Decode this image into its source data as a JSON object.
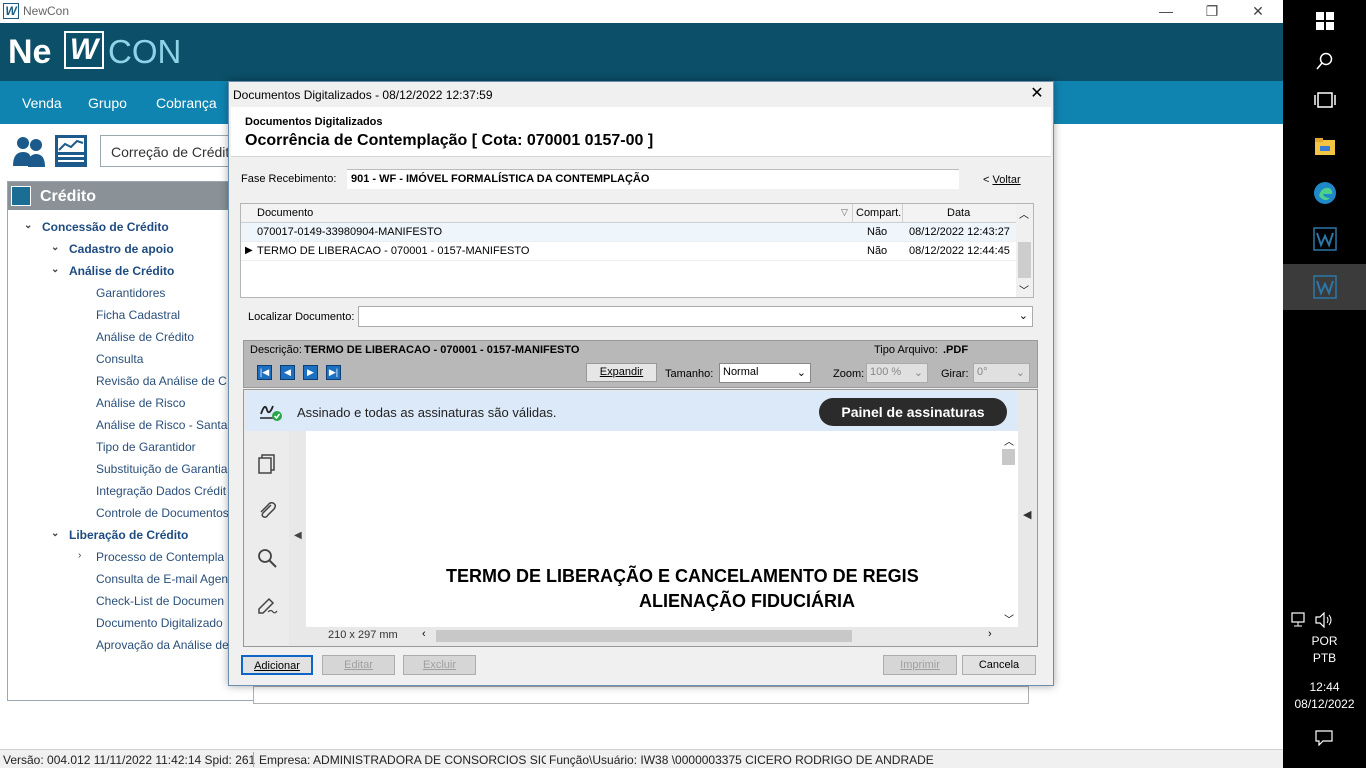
{
  "app": {
    "window_title": "NewCon",
    "logo": {
      "part1": "Ne",
      "part2": "W",
      "part3": "CON"
    },
    "menu": [
      "Venda",
      "Grupo",
      "Cobrança"
    ],
    "open_tab": "Correção de Crédito",
    "tree": {
      "header": "Crédito",
      "items": [
        {
          "label": "Concessão de Crédito",
          "bold": true,
          "level": 0,
          "expander": "v"
        },
        {
          "label": "Cadastro de apoio",
          "bold": true,
          "level": 1,
          "expander": "v"
        },
        {
          "label": "Análise de Crédito",
          "bold": true,
          "level": 1,
          "expander": "v"
        },
        {
          "label": "Garantidores",
          "level": 2
        },
        {
          "label": "Ficha Cadastral",
          "level": 2
        },
        {
          "label": "Análise de Crédito",
          "level": 2
        },
        {
          "label": "Consulta",
          "level": 2
        },
        {
          "label": "Revisão da Análise de C",
          "level": 2
        },
        {
          "label": "Análise de Risco",
          "level": 2
        },
        {
          "label": "Análise de Risco - Santa",
          "level": 2
        },
        {
          "label": "Tipo de Garantidor",
          "level": 2
        },
        {
          "label": "Substituição de Garantia",
          "level": 2
        },
        {
          "label": "Integração Dados Crédit",
          "level": 2
        },
        {
          "label": "Controle de Documentos",
          "level": 2
        },
        {
          "label": "Liberação de Crédito",
          "bold": true,
          "level": 1,
          "expander": "v"
        },
        {
          "label": "Processo de Contempla",
          "level": 2,
          "expander": ">"
        },
        {
          "label": "Consulta de E-mail Agen",
          "level": 2
        },
        {
          "label": "Check-List de Documen",
          "level": 2
        },
        {
          "label": "Documento Digitalizado",
          "level": 2
        },
        {
          "label": "Aprovação da Análise de",
          "level": 2
        }
      ]
    },
    "status": {
      "versao": "Versão: 004.012  11/11/2022 11:42:14  Spid: 261",
      "empresa": "Empresa: ADMINISTRADORA DE CONSORCIOS SICREI",
      "usuario": "Função\\Usuário: IW38  \\0000003375 CICERO RODRIGO DE ANDRADE"
    }
  },
  "dialog": {
    "title": "Documentos Digitalizados - 08/12/2022  12:37:59",
    "subtitle": "Documentos Digitalizados",
    "heading": "Ocorrência de Contemplação    [ Cota: 070001 0157-00 ]",
    "fase_label": "Fase Recebimento:",
    "fase_value": "901 - WF - IMÓVEL FORMALÍSTICA DA CONTEMPLAÇÃO",
    "voltar_prefix": "< ",
    "voltar_label": "Voltar",
    "grid": {
      "columns": [
        "Documento",
        "Compart.",
        "Data"
      ],
      "rows": [
        {
          "documento": "070017-0149-33980904-MANIFESTO",
          "compart": "Não",
          "data": "08/12/2022 12:43:27"
        },
        {
          "documento": "TERMO DE LIBERACAO - 070001 - 0157-MANIFESTO",
          "compart": "Não",
          "data": "08/12/2022 12:44:45"
        }
      ]
    },
    "localizar_label": "Localizar Documento:",
    "localizar_value": "",
    "viewer": {
      "descricao_label": "Descrição:",
      "descricao_value": "TERMO DE LIBERACAO - 070001 - 0157-MANIFESTO",
      "tipo_label": "Tipo Arquivo:",
      "tipo_value": ".PDF",
      "expandir": "Expandir",
      "tamanho_label": "Tamanho:",
      "tamanho_value": "Normal",
      "zoom_label": "Zoom:",
      "zoom_value": "100 %",
      "girar_label": "Girar:",
      "girar_value": "0°"
    },
    "pdf": {
      "signature_text": "Assinado e todas as assinaturas são válidas.",
      "signature_panel_button": "Painel de assinaturas",
      "title_line1": "TERMO DE LIBERAÇÃO E CANCELAMENTO DE REGIS",
      "title_line2": "ALIENAÇÃO FIDUCIÁRIA",
      "page_size": "210 x 297 mm"
    },
    "buttons": {
      "adicionar": "Adicionar",
      "editar": "Editar",
      "excluir": "Excluir",
      "imprimir": "Imprimir",
      "cancela": "Cancela"
    }
  },
  "taskbar": {
    "lang1": "POR",
    "lang2": "PTB",
    "time": "12:44",
    "date": "08/12/2022"
  },
  "colors": {
    "brand_dark": "#0b4f68",
    "menu_blue": "#0f84b0",
    "tree_header": "#8a9297",
    "signature_bar": "#dbe9f8"
  }
}
